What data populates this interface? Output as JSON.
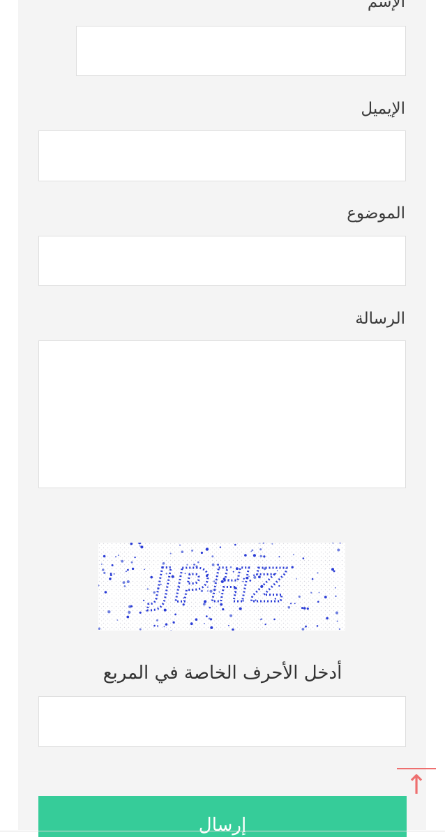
{
  "form": {
    "name_label": "الإسم",
    "name_value": "",
    "email_label": "الإيميل",
    "email_value": "",
    "subject_label": "الموضوع",
    "subject_value": "",
    "message_label": "الرسالة",
    "message_value": "",
    "captcha_text": "JPHZ",
    "captcha_caption": "أدخل الأحرف الخاصة في المربع",
    "captcha_value": "",
    "submit_label": "إرسال"
  },
  "colors": {
    "panel_bg": "#f4f4f4",
    "submit_bg": "#36cc99",
    "captcha_text": "#2a3cd6",
    "scroll_top": "#ee6f6f"
  },
  "icons": {
    "scroll_top": "arrow-up-icon"
  }
}
